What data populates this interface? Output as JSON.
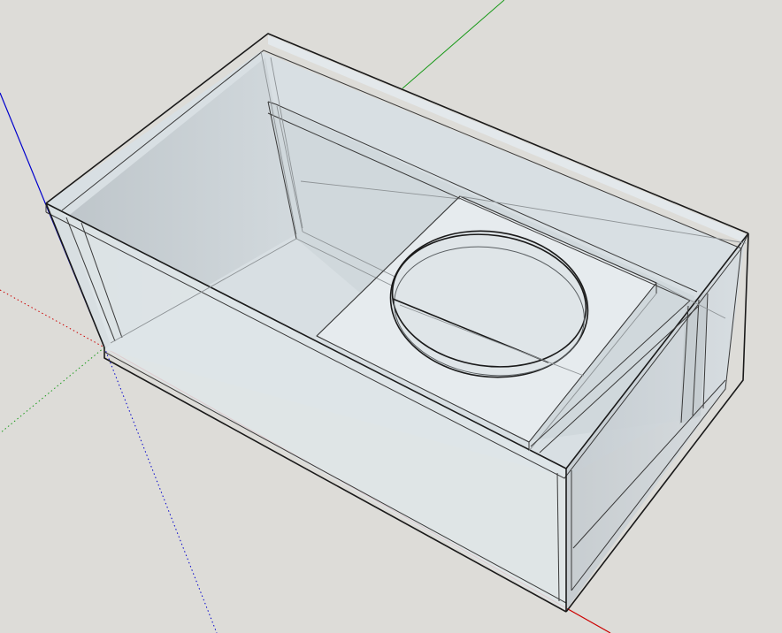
{
  "viewport": {
    "background_color": "#dddcd8",
    "glass_face_color": "#d9e0e4",
    "glass_face_dark": "#b9c1c6"
  },
  "axes": {
    "red_axis_color": "#cc0000",
    "green_axis_color": "#1a9a1a",
    "blue_axis_color": "#0000cc"
  },
  "model": {
    "name_icon": "subwoofer-enclosure-model"
  }
}
